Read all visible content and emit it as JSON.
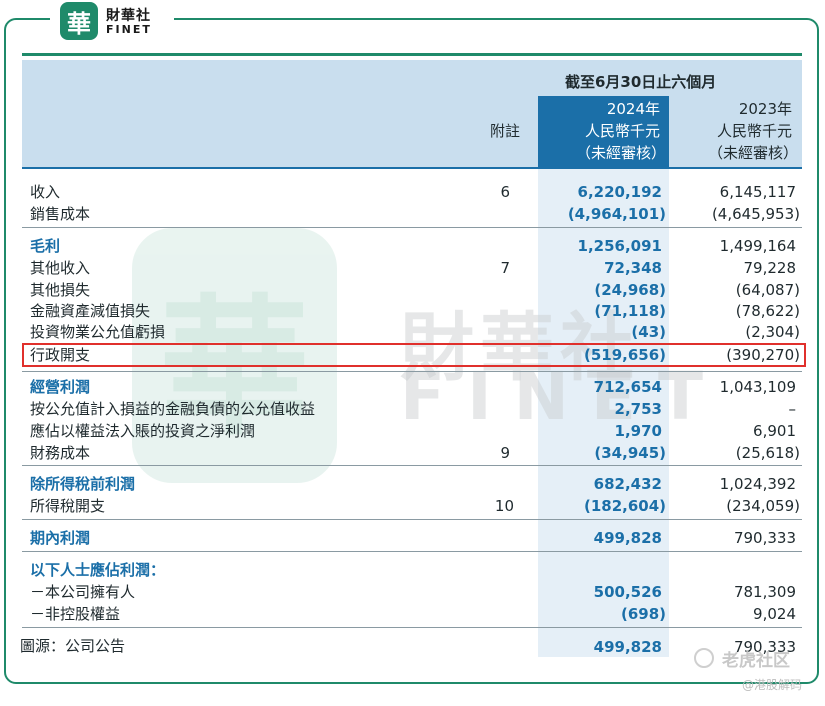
{
  "brand": {
    "mark": "華",
    "name_cn": "財華社",
    "name_en": "FINET"
  },
  "watermark": {
    "cn": "財華社",
    "en": "FINET"
  },
  "header": {
    "period": "截至6月30日止六個月",
    "note_label": "附註",
    "col2024": {
      "year": "2024年",
      "unit": "人民幣千元",
      "status": "（未經審核）"
    },
    "col2023": {
      "year": "2023年",
      "unit": "人民幣千元",
      "status": "（未經審核）"
    }
  },
  "rows": [
    {
      "label": "收入",
      "note": "6",
      "v2024": "6,220,192",
      "v2023": "6,145,117"
    },
    {
      "label": "銷售成本",
      "note": "",
      "v2024": "(4,964,101)",
      "v2023": "(4,645,953)"
    },
    {
      "label": "毛利",
      "note": "",
      "v2024": "1,256,091",
      "v2023": "1,499,164"
    },
    {
      "label": "其他收入",
      "note": "7",
      "v2024": "72,348",
      "v2023": "79,228"
    },
    {
      "label": "其他損失",
      "note": "",
      "v2024": "(24,968)",
      "v2023": "(64,087)"
    },
    {
      "label": "金融資產減值損失",
      "note": "",
      "v2024": "(71,118)",
      "v2023": "(78,622)"
    },
    {
      "label": "投資物業公允值虧損",
      "note": "",
      "v2024": "(43)",
      "v2023": "(2,304)"
    },
    {
      "label": "行政開支",
      "note": "",
      "v2024": "(519,656)",
      "v2023": "(390,270)"
    },
    {
      "label": "經營利潤",
      "note": "",
      "v2024": "712,654",
      "v2023": "1,043,109"
    },
    {
      "label": "按公允值計入損益的金融負債的公允值收益",
      "note": "",
      "v2024": "2,753",
      "v2023": "–"
    },
    {
      "label": "應佔以權益法入賬的投資之淨利潤",
      "note": "",
      "v2024": "1,970",
      "v2023": "6,901"
    },
    {
      "label": "財務成本",
      "note": "9",
      "v2024": "(34,945)",
      "v2023": "(25,618)"
    },
    {
      "label": "除所得稅前利潤",
      "note": "",
      "v2024": "682,432",
      "v2023": "1,024,392"
    },
    {
      "label": "所得稅開支",
      "note": "10",
      "v2024": "(182,604)",
      "v2023": "(234,059)"
    },
    {
      "label": "期內利潤",
      "note": "",
      "v2024": "499,828",
      "v2023": "790,333"
    },
    {
      "label": "以下人士應佔利潤：",
      "note": "",
      "v2024": "",
      "v2023": ""
    },
    {
      "label": "－本公司擁有人",
      "note": "",
      "v2024": "500,526",
      "v2023": "781,309"
    },
    {
      "label": "－非控股權益",
      "note": "",
      "v2024": "(698)",
      "v2023": "9,024"
    },
    {
      "label": "",
      "note": "",
      "v2024": "499,828",
      "v2023": "790,333"
    }
  ],
  "source": "圖源：公司公告",
  "overlay": {
    "site": "老虎社区",
    "handle": "@港股解码"
  },
  "colors": {
    "brand_green": "#1f8a6a",
    "blue": "#1b6fa8",
    "header_bg": "#c9deee",
    "highlight": "#e0302c"
  }
}
